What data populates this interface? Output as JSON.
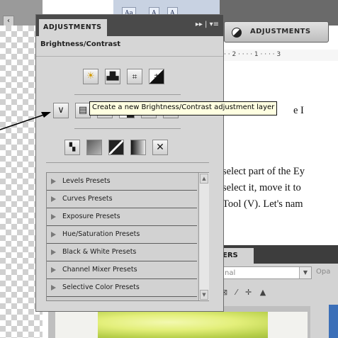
{
  "doc": {
    "font_buttons": [
      "Aa",
      "A",
      "A"
    ],
    "ruler_text": "· · 2 · · · · 1 · · · · 3",
    "lines": [
      "select part of the Ey",
      "select it, move it to",
      "Tool (V). Let's nam"
    ],
    "tooltip_fragment": "e I"
  },
  "adjustments_button": {
    "label": "ADJUSTMENTS"
  },
  "panel": {
    "tab": "ADJUSTMENTS",
    "menu_icons": "▸▸ | ▾≡",
    "title": "Brightness/Contrast"
  },
  "tooltip": "Create a new Brightness/Contrast adjustment layer",
  "presets": [
    "Levels Presets",
    "Curves Presets",
    "Exposure Presets",
    "Hue/Saturation Presets",
    "Black & White Presets",
    "Channel Mixer Presets",
    "Selective Color Presets"
  ],
  "layers": {
    "tab": "ERS",
    "blend_mode": "nal",
    "opacity_label": "Opa",
    "lock_icons": "⊠ ⁄ ✛ ▲"
  },
  "icons": {
    "row1": [
      "brightness-icon",
      "levels-icon",
      "curves-icon",
      "exposure-icon"
    ],
    "row2": [
      "vibrance-icon",
      "hue-saturation-icon",
      "color-balance-icon",
      "black-white-icon",
      "photo-filter-icon",
      "channel-mixer-icon"
    ],
    "row3": [
      "invert-icon",
      "posterize-icon",
      "threshold-icon",
      "gradient-map-icon",
      "selective-color-icon"
    ]
  }
}
